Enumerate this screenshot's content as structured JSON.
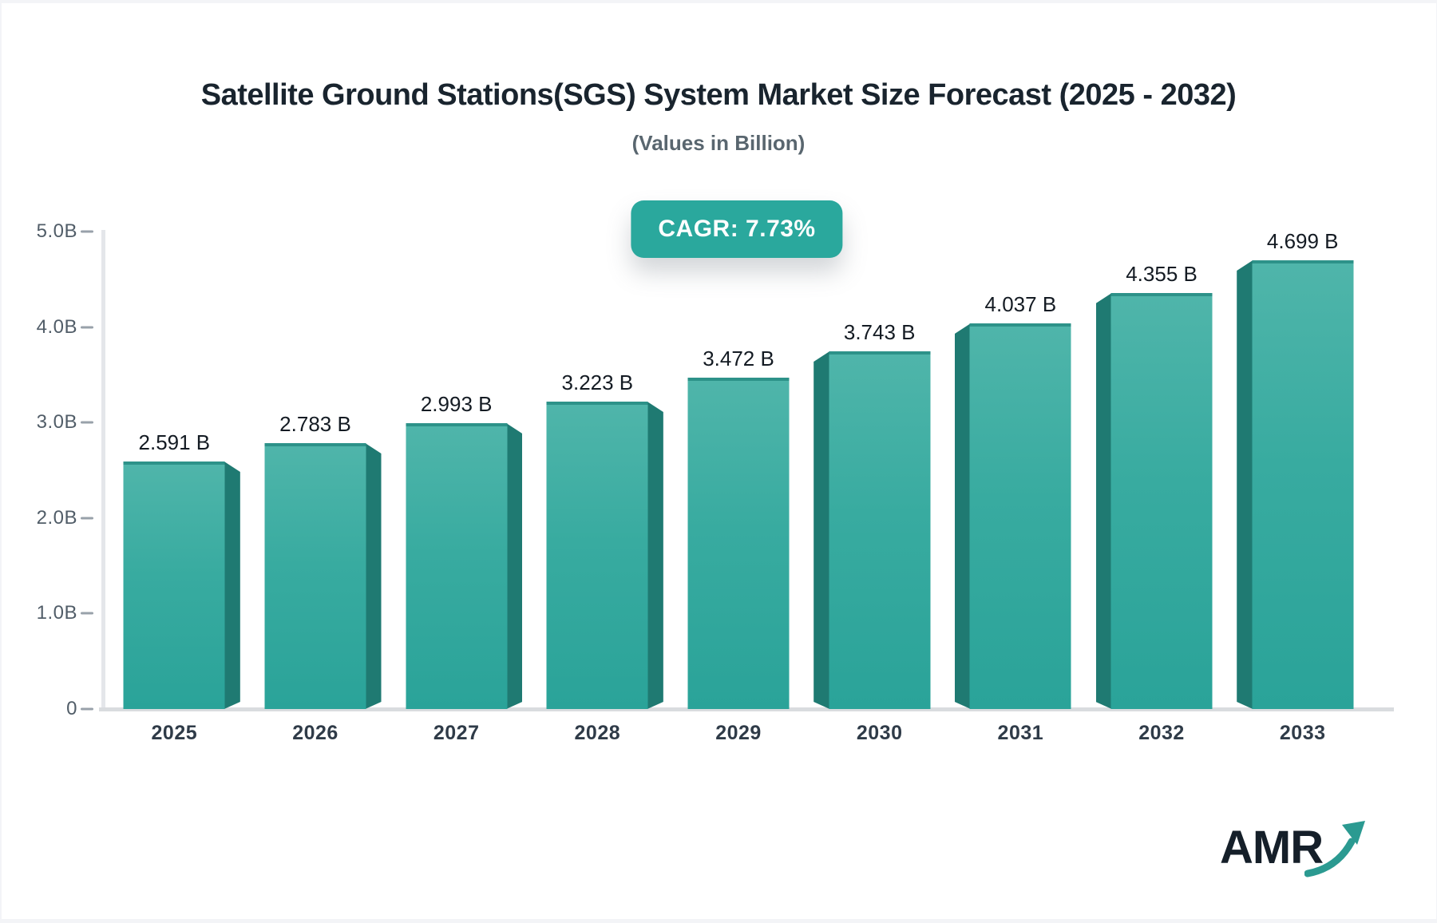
{
  "header": {
    "title": "Satellite Ground Stations(SGS) System Market Size Forecast (2025 - 2032)",
    "subtitle": "(Values in Billion)"
  },
  "badge": {
    "label": "CAGR: 7.73%"
  },
  "logo": {
    "text": "AMR",
    "icon": "growth-arrow-icon"
  },
  "colors": {
    "bar_face_top": "#4FB5AA",
    "bar_face_mid": "#38ABA0",
    "bar_face_bottom": "#2AA399",
    "bar_side": "#1F7A72",
    "bar_top_edge": "#2D9289",
    "badge_bg": "#2AA89D",
    "accent_teal": "#2B9A91",
    "title_text": "#19242E",
    "subtitle_text": "#59666F",
    "axis_text": "#515D68",
    "x_label_text": "#2F3B48",
    "value_text": "#141B23",
    "axis_line": "#E4E6EA",
    "baseline": "#D9DCDF",
    "tick_dash": "#98A1AA",
    "page_bg": "#F3F4F7",
    "card_bg": "#FFFFFF"
  },
  "chart_data": {
    "type": "bar",
    "title": "Satellite Ground Stations(SGS) System Market Size Forecast (2025 - 2032)",
    "subtitle": "(Values in Billion)",
    "cagr_label": "CAGR: 7.73%",
    "categories": [
      "2025",
      "2026",
      "2027",
      "2028",
      "2029",
      "2030",
      "2031",
      "2032",
      "2033"
    ],
    "values": [
      2.591,
      2.783,
      2.993,
      3.223,
      3.472,
      3.743,
      4.037,
      4.355,
      4.699
    ],
    "value_labels": [
      "2.591 B",
      "2.783 B",
      "2.993 B",
      "3.223 B",
      "3.472 B",
      "3.743 B",
      "4.037 B",
      "4.355 B",
      "4.699 B"
    ],
    "xlabel": "",
    "ylabel": "",
    "ylim": [
      0,
      5
    ],
    "yticks": [
      {
        "value": 0,
        "label": "0"
      },
      {
        "value": 1,
        "label": "1.0B"
      },
      {
        "value": 2,
        "label": "2.0B"
      },
      {
        "value": 3,
        "label": "3.0B"
      },
      {
        "value": 4,
        "label": "4.0B"
      },
      {
        "value": 5,
        "label": "5.0B"
      }
    ],
    "grid": false,
    "legend": false,
    "bar_style": "3d-extruded, perspective vanishing toward center bar"
  }
}
